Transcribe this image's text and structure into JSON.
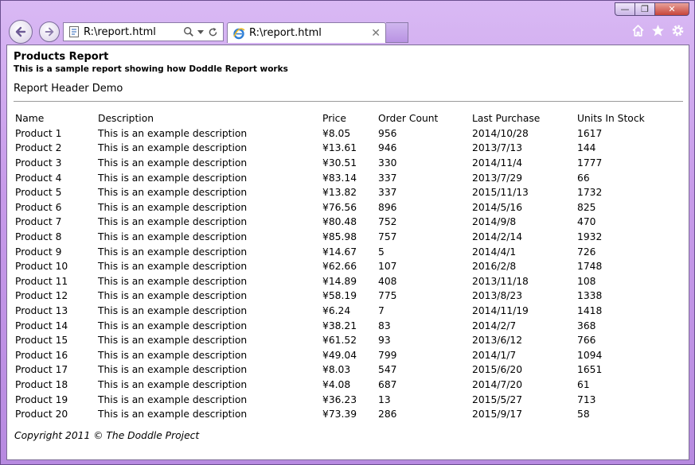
{
  "browser": {
    "address_url": "R:\\report.html",
    "tab_title": "R:\\report.html",
    "window_buttons": {
      "minimize": "—",
      "restore": "❐",
      "close": "✕"
    }
  },
  "report": {
    "title": "Products Report",
    "subtitle": "This is a sample report showing how Doddle Report works",
    "header_text": "Report Header Demo",
    "columns": [
      "Name",
      "Description",
      "Price",
      "Order Count",
      "Last Purchase",
      "Units In Stock"
    ],
    "rows": [
      [
        "Product 1",
        "This is an example description",
        "¥8.05",
        "956",
        "2014/10/28",
        "1617"
      ],
      [
        "Product 2",
        "This is an example description",
        "¥13.61",
        "946",
        "2013/7/13",
        "144"
      ],
      [
        "Product 3",
        "This is an example description",
        "¥30.51",
        "330",
        "2014/11/4",
        "1777"
      ],
      [
        "Product 4",
        "This is an example description",
        "¥83.14",
        "337",
        "2013/7/29",
        "66"
      ],
      [
        "Product 5",
        "This is an example description",
        "¥13.82",
        "337",
        "2015/11/13",
        "1732"
      ],
      [
        "Product 6",
        "This is an example description",
        "¥76.56",
        "896",
        "2014/5/16",
        "825"
      ],
      [
        "Product 7",
        "This is an example description",
        "¥80.48",
        "752",
        "2014/9/8",
        "470"
      ],
      [
        "Product 8",
        "This is an example description",
        "¥85.98",
        "757",
        "2014/2/14",
        "1932"
      ],
      [
        "Product 9",
        "This is an example description",
        "¥14.67",
        "5",
        "2014/4/1",
        "726"
      ],
      [
        "Product 10",
        "This is an example description",
        "¥62.66",
        "107",
        "2016/2/8",
        "1748"
      ],
      [
        "Product 11",
        "This is an example description",
        "¥14.89",
        "408",
        "2013/11/18",
        "108"
      ],
      [
        "Product 12",
        "This is an example description",
        "¥58.19",
        "775",
        "2013/8/23",
        "1338"
      ],
      [
        "Product 13",
        "This is an example description",
        "¥6.24",
        "7",
        "2014/11/19",
        "1418"
      ],
      [
        "Product 14",
        "This is an example description",
        "¥38.21",
        "83",
        "2014/2/7",
        "368"
      ],
      [
        "Product 15",
        "This is an example description",
        "¥61.52",
        "93",
        "2013/6/12",
        "766"
      ],
      [
        "Product 16",
        "This is an example description",
        "¥49.04",
        "799",
        "2014/1/7",
        "1094"
      ],
      [
        "Product 17",
        "This is an example description",
        "¥8.03",
        "547",
        "2015/6/20",
        "1651"
      ],
      [
        "Product 18",
        "This is an example description",
        "¥4.08",
        "687",
        "2014/7/20",
        "61"
      ],
      [
        "Product 19",
        "This is an example description",
        "¥36.23",
        "13",
        "2015/5/27",
        "713"
      ],
      [
        "Product 20",
        "This is an example description",
        "¥73.39",
        "286",
        "2015/9/17",
        "58"
      ]
    ],
    "footer": "Copyright 2011 © The Doddle Project"
  }
}
